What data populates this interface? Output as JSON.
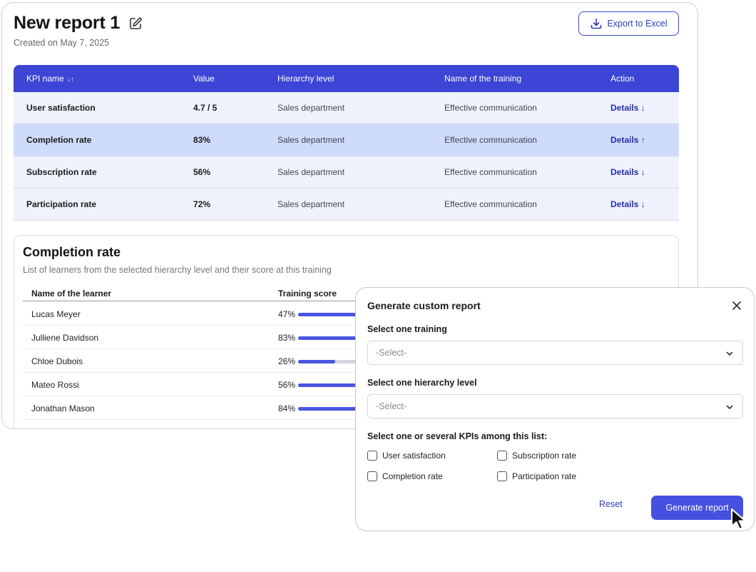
{
  "report": {
    "title": "New report 1",
    "created": "Created on May 7, 2025",
    "export_label": "Export to Excel"
  },
  "kpi_table": {
    "headers": {
      "kpi_name": "KPI name",
      "sort_glyph": "↓↑",
      "value": "Value",
      "hierarchy": "Hierarchy level",
      "training": "Name of the training",
      "action": "Action"
    },
    "rows": [
      {
        "kpi": "User satisfaction",
        "value": "4.7 / 5",
        "hierarchy": "Sales department",
        "training": "Effective communication",
        "action": "Details ↓"
      },
      {
        "kpi": "Completion rate",
        "value": "83%",
        "hierarchy": "Sales department",
        "training": "Effective communication",
        "action": "Details ↑"
      },
      {
        "kpi": "Subscription rate",
        "value": "56%",
        "hierarchy": "Sales department",
        "training": "Effective communication",
        "action": "Details ↓"
      },
      {
        "kpi": "Participation rate",
        "value": "72%",
        "hierarchy": "Sales department",
        "training": "Effective communication",
        "action": "Details ↓"
      }
    ]
  },
  "completion": {
    "title": "Completion rate",
    "subtitle": "List of learners from the selected hierarchy level and their score at this training",
    "col_learner": "Name of the learner",
    "col_score": "Training score",
    "learners": [
      {
        "name": "Lucas Meyer",
        "score": "47%",
        "fraction": 0.47
      },
      {
        "name": "Julliene Davidson",
        "score": "83%",
        "fraction": 0.83
      },
      {
        "name": "Chloe Dubois",
        "score": "26%",
        "fraction": 0.26
      },
      {
        "name": "Mateo Rossi",
        "score": "56%",
        "fraction": 0.56
      },
      {
        "name": "Jonathan Mason",
        "score": "84%",
        "fraction": 0.84
      }
    ]
  },
  "modal": {
    "title": "Generate custom report",
    "training_label": "Select one training",
    "training_placeholder": "-Select-",
    "hierarchy_label": "Select one hierarchy level",
    "hierarchy_placeholder": "-Select-",
    "kpi_label": "Select one or several KPIs among this list:",
    "kpis": [
      "User satisfaction",
      "Subscription rate",
      "Completion rate",
      "Participation rate"
    ],
    "reset_label": "Reset",
    "generate_label": "Generate report"
  },
  "colors": {
    "accent": "#3d45d6",
    "row_bg": "#eff2fc",
    "row_selected": "#cfdbfa",
    "bar_fill": "#4a55e0"
  }
}
